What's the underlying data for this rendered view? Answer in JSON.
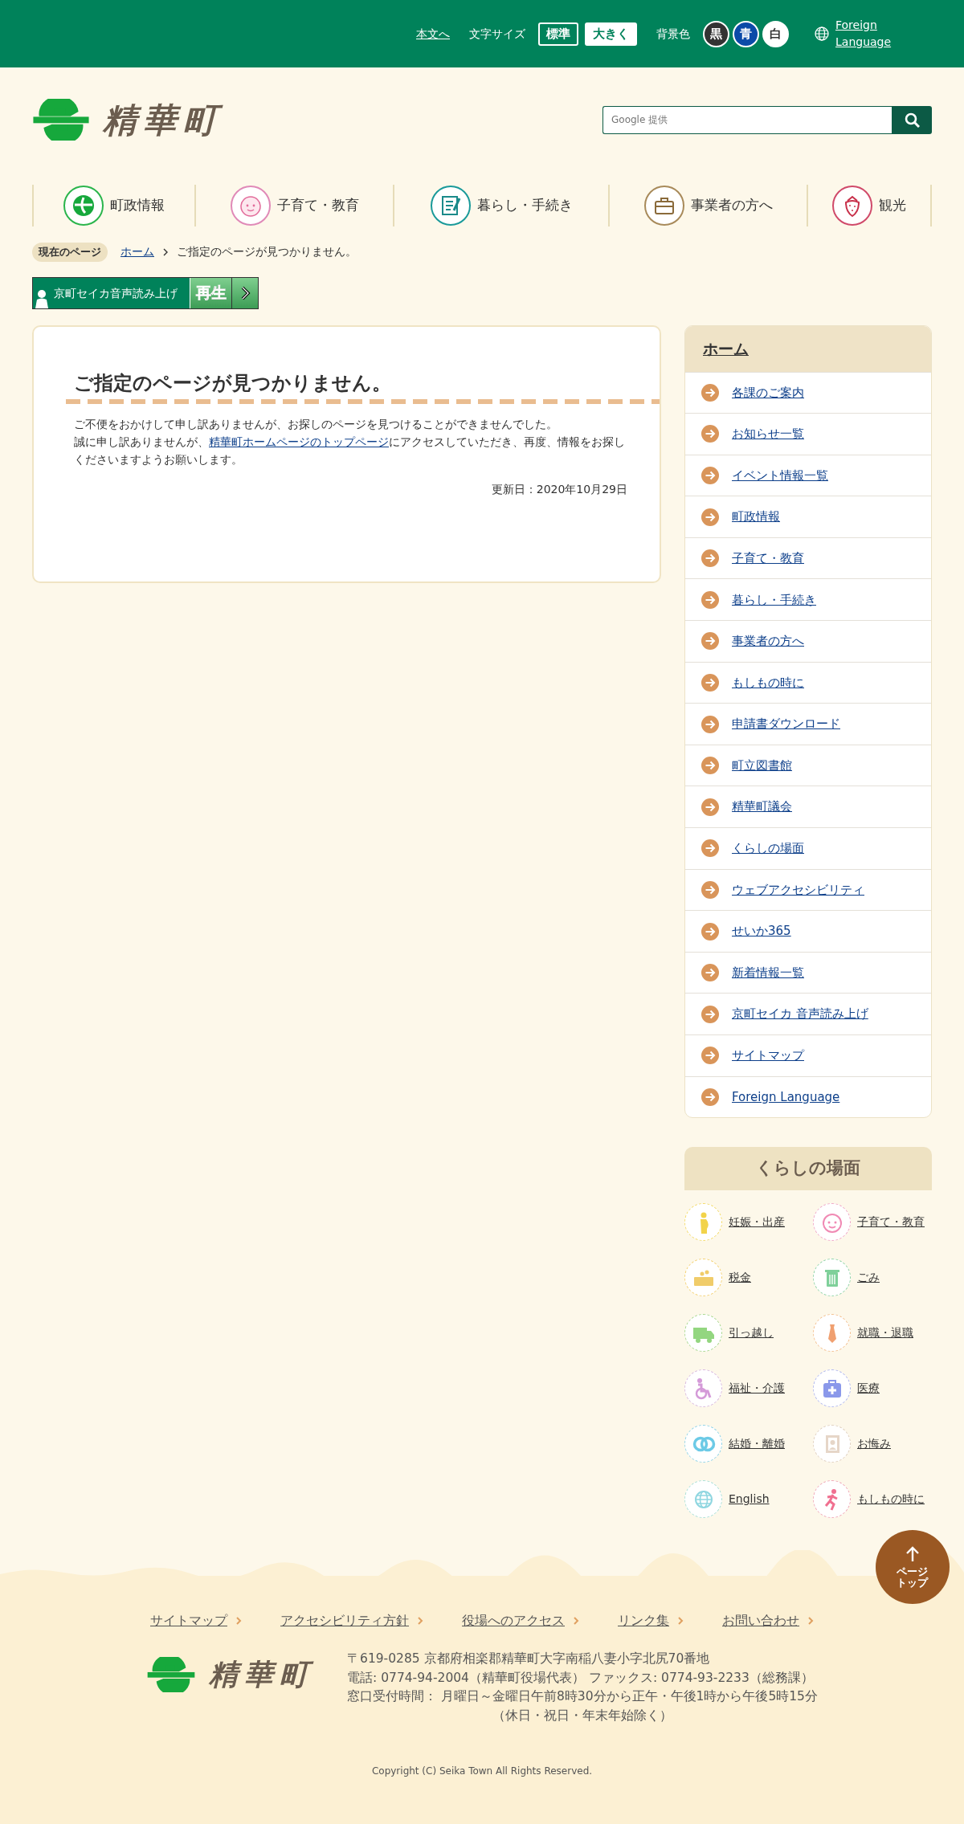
{
  "top_bar": {
    "skip_link": "本文へ",
    "font_size_label": "文字サイズ",
    "font_sizes": [
      {
        "label": "標準",
        "selected": true
      },
      {
        "label": "大きく",
        "selected": false
      }
    ],
    "bg_color_label": "背景色",
    "bg_colors": [
      {
        "label": "黒",
        "color": "#333333"
      },
      {
        "label": "青",
        "color": "#0b4aa8"
      },
      {
        "label": "白",
        "color": "#ffffff"
      }
    ],
    "language_link": "Foreign Language"
  },
  "header": {
    "logo_text": "精華町",
    "search": {
      "placeholder": "Google 提供"
    }
  },
  "nav": [
    {
      "label": "町政情報"
    },
    {
      "label": "子育て・教育"
    },
    {
      "label": "暮らし・手続き"
    },
    {
      "label": "事業者の方へ"
    },
    {
      "label": "観光"
    }
  ],
  "breadcrumb": {
    "label": "現在のページ",
    "home": "ホーム",
    "current": "ご指定のページが見つかりません。"
  },
  "voice_reader": {
    "label": "京町セイカ音声読み上げ",
    "play": "再生"
  },
  "main": {
    "title": "ご指定のページが見つかりません。",
    "paragraph_1": "ご不便をおかけして申し訳ありませんが、お探しのページを見つけることができませんでした。",
    "paragraph_2": {
      "before": "誠に申し訳ありませんが、",
      "link": "精華町ホームページのトップページ",
      "after": "にアクセスしていただき、再度、情報をお探しくださいますようお願いします。"
    },
    "updated": "更新日：2020年10月29日"
  },
  "sidebar": {
    "title": "ホーム",
    "items": [
      "各課のご案内",
      "お知らせ一覧",
      "イベント情報一覧",
      "町政情報",
      "子育て・教育",
      "暮らし・手続き",
      "事業者の方へ",
      "もしもの時に",
      "申請書ダウンロード",
      "町立図書館",
      "精華町議会",
      "くらしの場面",
      "ウェブアクセシビリティ",
      "せいか365",
      "新着情報一覧",
      "京町セイカ 音声読み上げ",
      "サイトマップ",
      "Foreign Language"
    ]
  },
  "life_scenes": {
    "title": "くらしの場面",
    "items": [
      "妊娠・出産",
      "子育て・教育",
      "税金",
      "ごみ",
      "引っ越し",
      "就職・退職",
      "福祉・介護",
      "医療",
      "結婚・離婚",
      "お悔み",
      "English",
      "もしもの時に"
    ]
  },
  "page_top": "ページトップ",
  "footer": {
    "links": [
      "サイトマップ",
      "アクセシビリティ方針",
      "役場へのアクセス",
      "リンク集",
      "お問い合わせ"
    ],
    "logo_text": "精華町",
    "address": "〒619-0285 京都府相楽郡精華町大字南稲八妻小字北尻70番地",
    "contact": "電話: 0774-94-2004（精華町役場代表） ファックス: 0774-93-2233（総務課）",
    "hours": "窓口受付時間： 月曜日～金曜日午前8時30分から正午・午後1時から午後5時15分",
    "hours_note": "（休日・祝日・年末年始除く）",
    "copyright": "Copyright (C) Seika Town All Rights Reserved."
  }
}
